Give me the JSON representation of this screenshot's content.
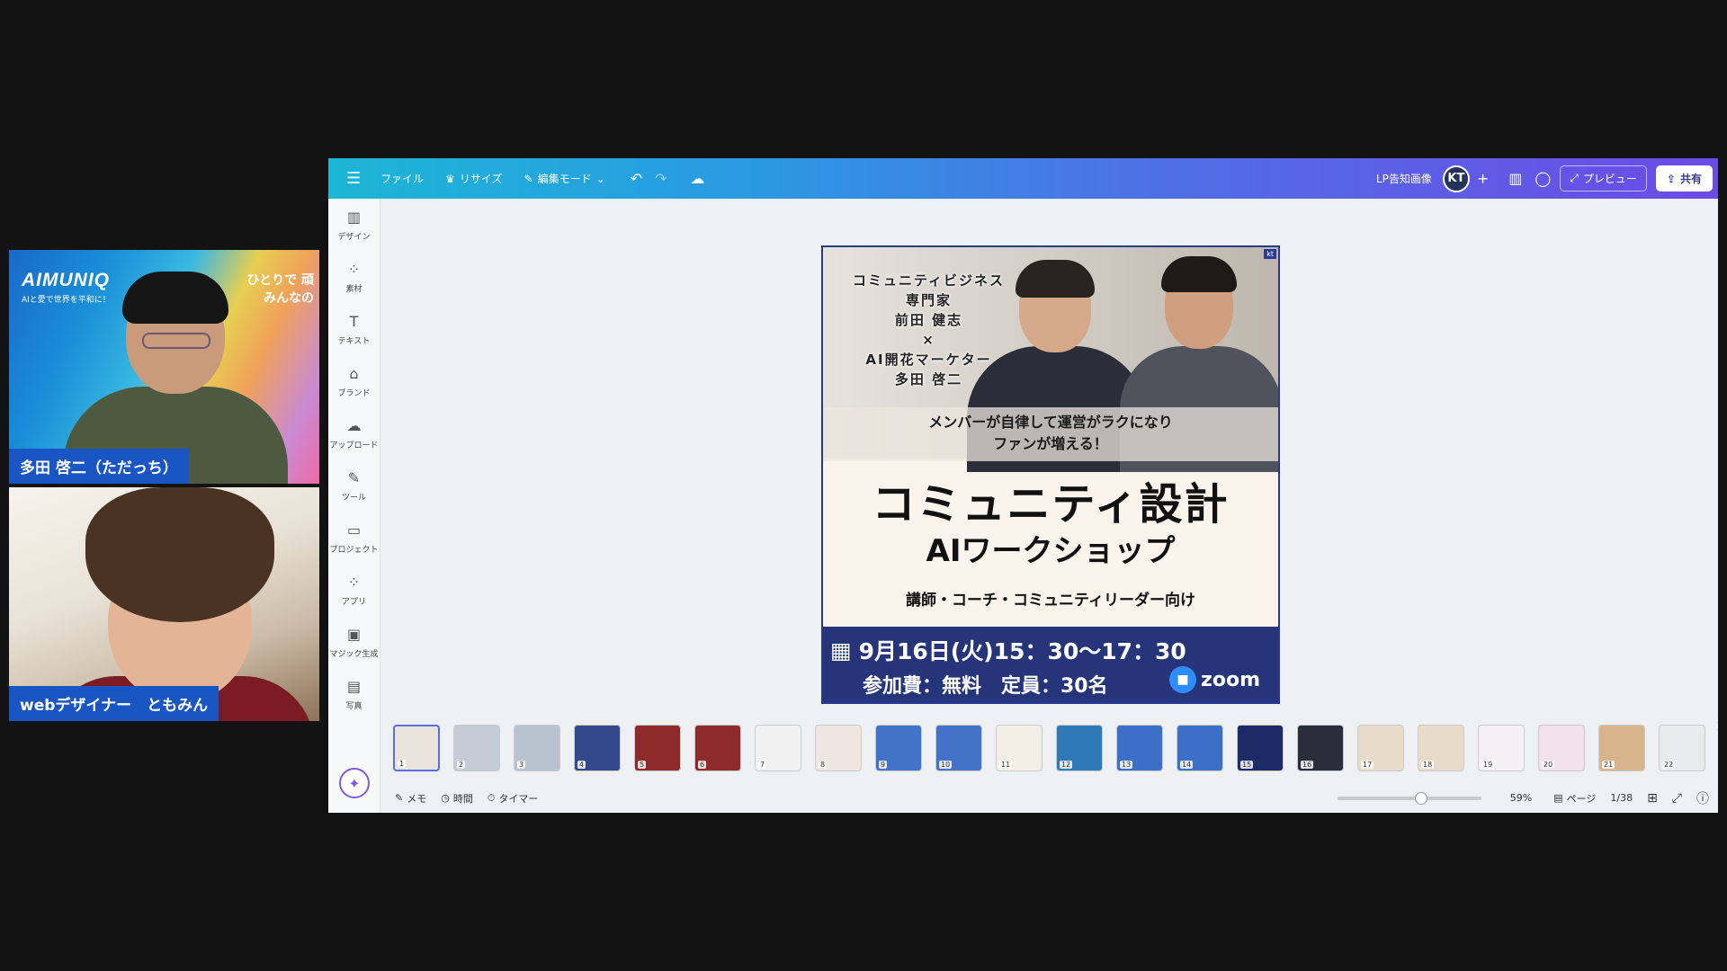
{
  "video_tiles": [
    {
      "name_tag": "多田 啓二（ただっち）",
      "brand": "AIMUNIQ",
      "brand_sub": "AIと愛で世界を平和に！",
      "corner_text_1": "ひとりで 頑",
      "corner_text_2": "みんなの"
    },
    {
      "name_tag": "webデザイナー　ともみん"
    }
  ],
  "toolbar": {
    "menu_icon": "☰",
    "file": "ファイル",
    "resize": "リサイズ",
    "edit_mode": "編集モード",
    "doc_title": "LP告知画像",
    "avatar": "KT",
    "add": "+",
    "preview": "プレビュー",
    "share": "共有"
  },
  "sidebar": {
    "items": [
      {
        "label": "デザイン",
        "icon": "design-icon",
        "glyph": "▥"
      },
      {
        "label": "素材",
        "icon": "elements-icon",
        "glyph": "⁘"
      },
      {
        "label": "テキスト",
        "icon": "text-icon",
        "glyph": "T"
      },
      {
        "label": "ブランド",
        "icon": "brand-icon",
        "glyph": "⌂"
      },
      {
        "label": "アップロード",
        "icon": "upload-icon",
        "glyph": "☁"
      },
      {
        "label": "ツール",
        "icon": "tools-icon",
        "glyph": "✎"
      },
      {
        "label": "プロジェクト",
        "icon": "projects-icon",
        "glyph": "▭"
      },
      {
        "label": "アプリ",
        "icon": "apps-icon",
        "glyph": "⁘"
      },
      {
        "label": "マジック生成",
        "icon": "magic-media-icon",
        "glyph": "▣"
      },
      {
        "label": "写真",
        "icon": "photos-icon",
        "glyph": "▤"
      }
    ]
  },
  "design": {
    "kt_badge": "kt",
    "speaker_lines": [
      "コミュニティビジネス",
      "専門家",
      "前田 健志",
      "×",
      "AI開花マーケター",
      "多田 啓二"
    ],
    "tagline_1": "メンバーが自律して運営がラクになり",
    "tagline_2": "ファンが増える！",
    "title": "コミュニティ設計",
    "subtitle": "AIワークショップ",
    "audience": "講師・コーチ・コミュニティリーダー向け",
    "date": "9月16日(火)15：30〜17：30",
    "fee": "参加費：無料　定員：30名",
    "zoom": "zoom"
  },
  "thumbnails": [
    {
      "n": "1",
      "c": "#e9e3dc"
    },
    {
      "n": "2",
      "c": "#c6ccd6"
    },
    {
      "n": "3",
      "c": "#b9c3cf"
    },
    {
      "n": "4",
      "c": "#314a8c"
    },
    {
      "n": "5",
      "c": "#8e2a2a"
    },
    {
      "n": "6",
      "c": "#8e2a2a"
    },
    {
      "n": "7",
      "c": "#f1f1f1"
    },
    {
      "n": "8",
      "c": "#efe6e1"
    },
    {
      "n": "9",
      "c": "#4273c8"
    },
    {
      "n": "10",
      "c": "#4273c8"
    },
    {
      "n": "11",
      "c": "#f3efe6"
    },
    {
      "n": "12",
      "c": "#2e7ab8"
    },
    {
      "n": "13",
      "c": "#3c70c6"
    },
    {
      "n": "14",
      "c": "#3c70c6"
    },
    {
      "n": "15",
      "c": "#1c2a66"
    },
    {
      "n": "16",
      "c": "#2a2d3a"
    },
    {
      "n": "17",
      "c": "#e7dcc9"
    },
    {
      "n": "18",
      "c": "#e7dcc9"
    },
    {
      "n": "19",
      "c": "#f4f0f4"
    },
    {
      "n": "20",
      "c": "#f1e2ec"
    },
    {
      "n": "21",
      "c": "#d8b48c"
    },
    {
      "n": "22",
      "c": "#e9eaec"
    }
  ],
  "footer": {
    "notes": "メモ",
    "duration": "時間",
    "timer": "タイマー",
    "zoom_level": "59%",
    "zoom_fraction": 0.59,
    "pages_label": "ページ",
    "page_count": "1/38"
  },
  "colors": {
    "topbar_start": "#1cb6d6",
    "topbar_end": "#6c4be6",
    "name_tag": "#1a55c4",
    "design_info_bar": "#26357a",
    "zoom_blue": "#2d8cff"
  }
}
